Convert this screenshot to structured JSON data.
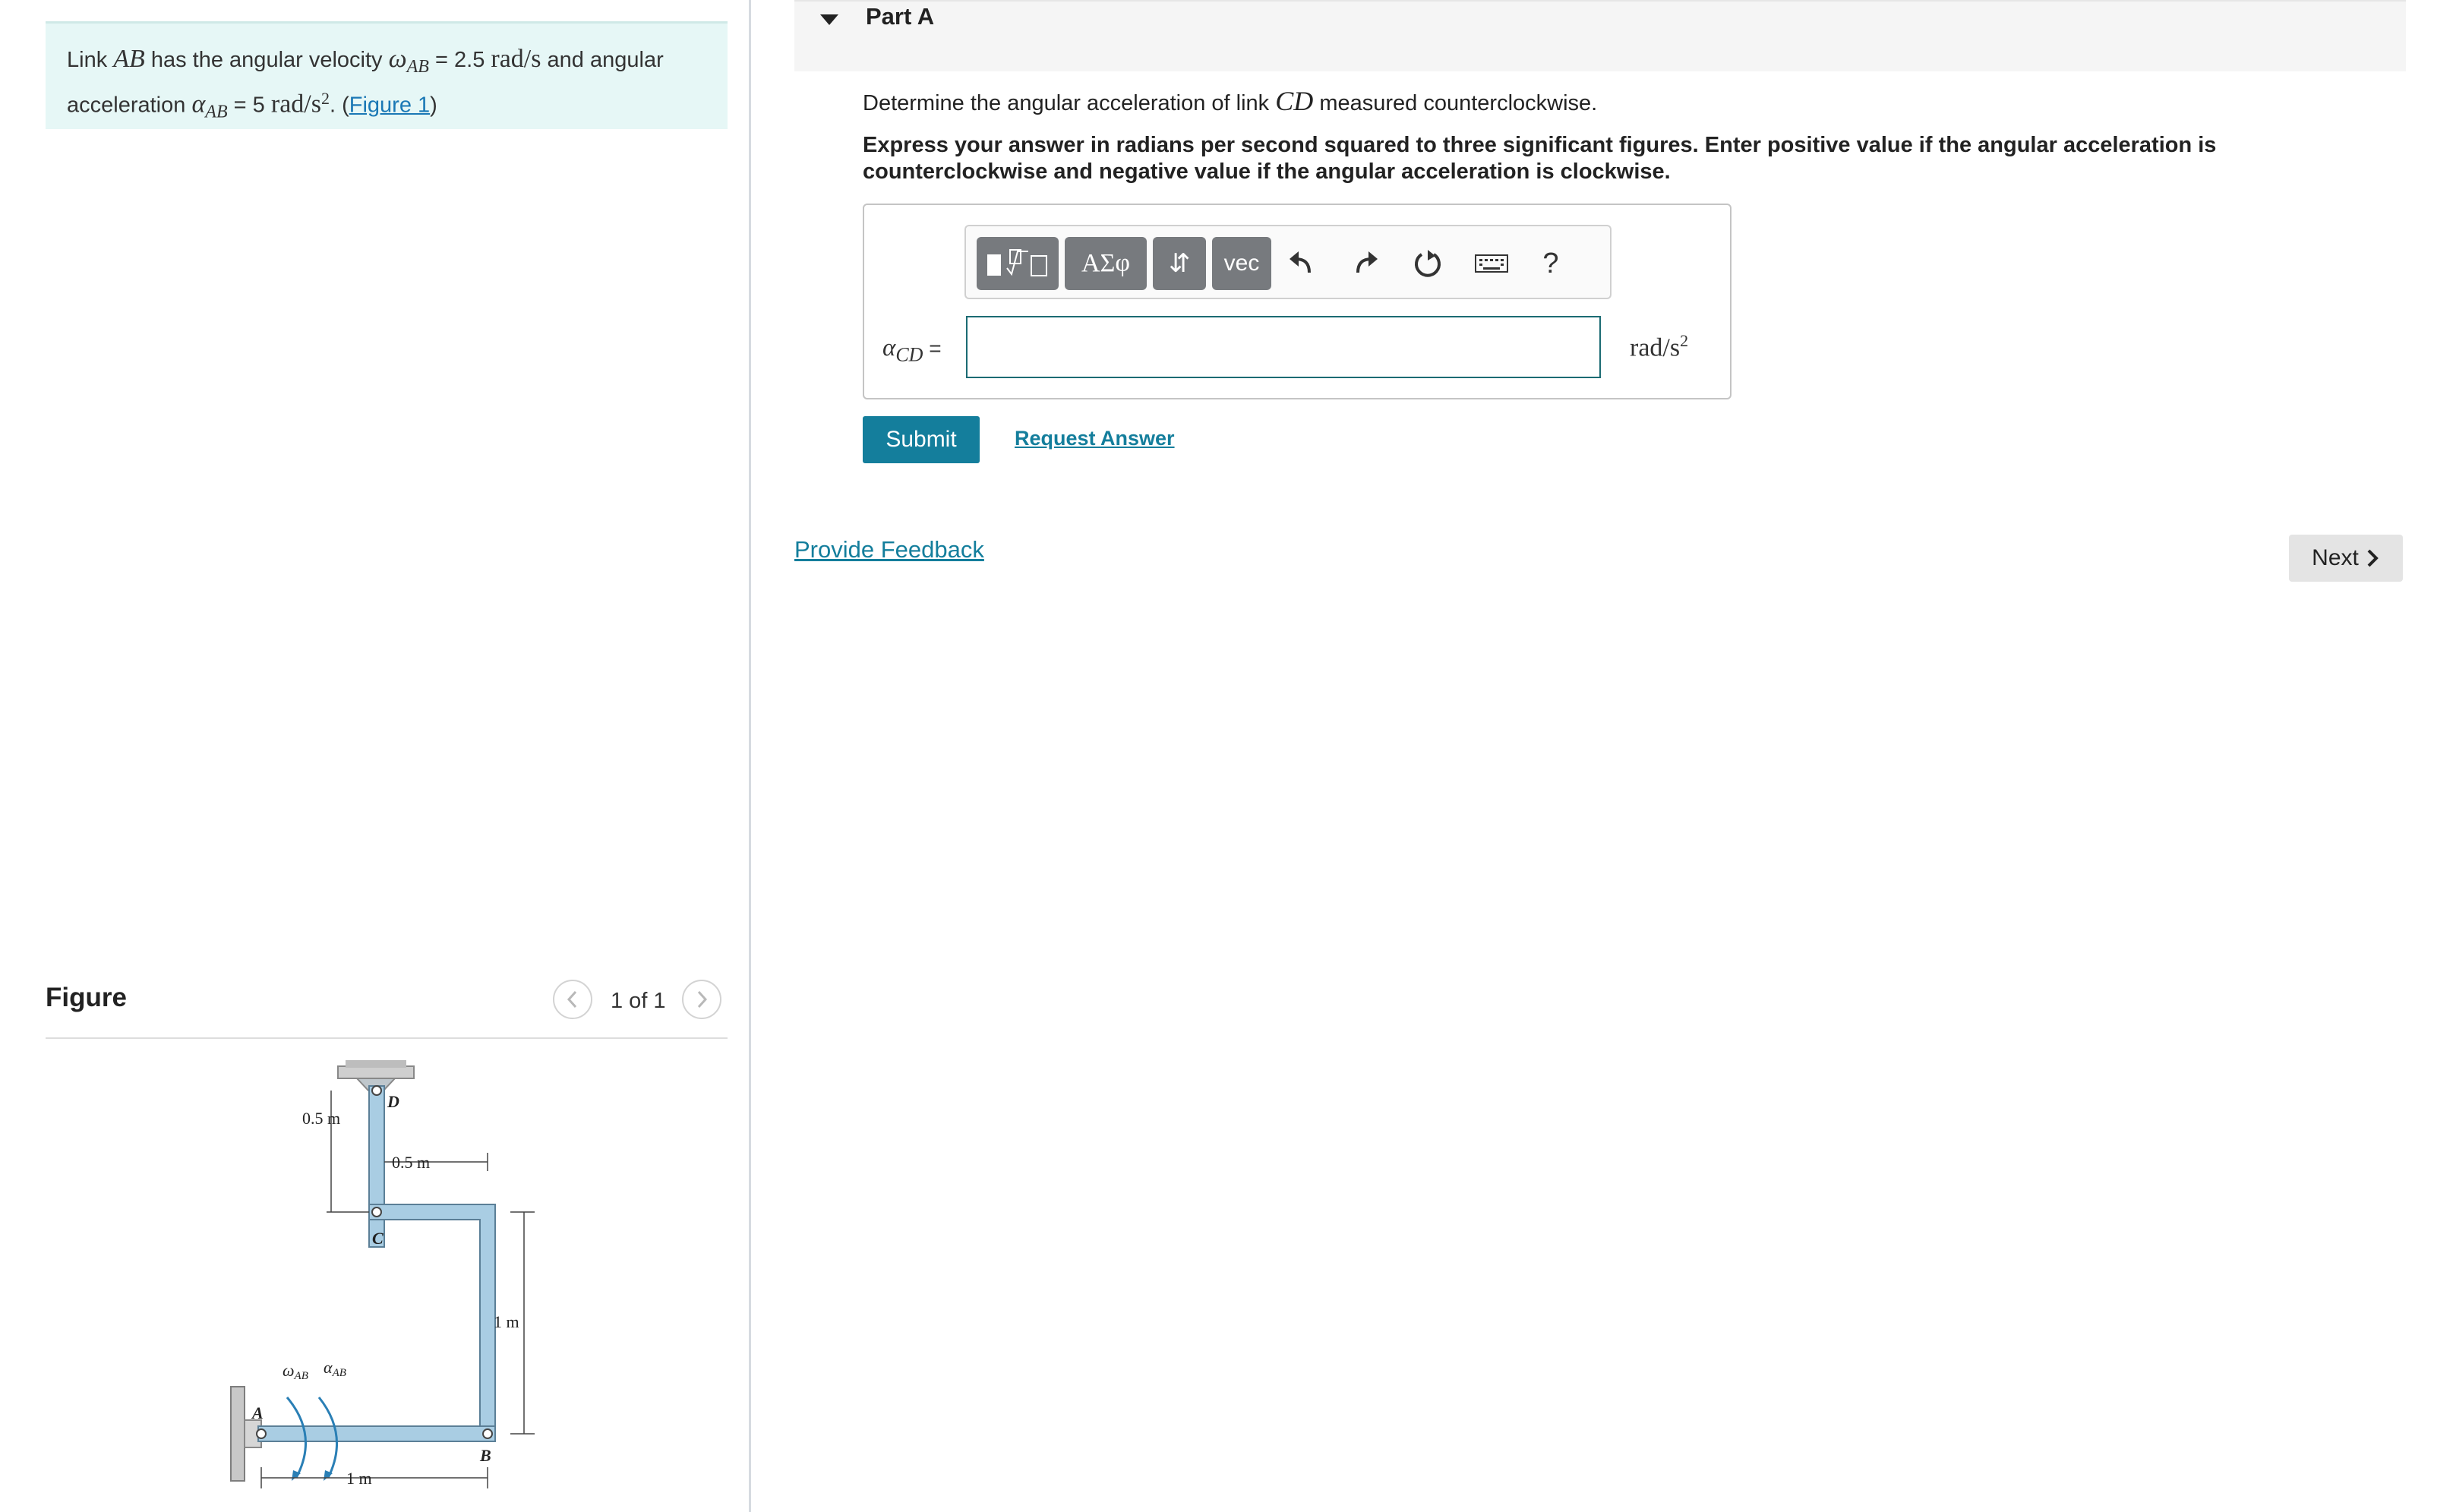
{
  "problem": {
    "intro": "Link ",
    "link_name": "AB",
    "velocity_text": " has the angular velocity ",
    "omega_symbol": "ω",
    "omega_sub": "AB",
    "omega_eq": " = 2.5 ",
    "omega_unit": "rad/s",
    "and_text": " and angular",
    "accel_text": "acceleration ",
    "alpha_symbol": "α",
    "alpha_sub": "AB",
    "alpha_eq": " = 5 ",
    "alpha_unit": "rad/s",
    "alpha_unit_exp": "2",
    "period": ". (",
    "figure_link": "Figure 1",
    "close": ")"
  },
  "figure": {
    "title": "Figure",
    "counter": "1 of 1",
    "labels": {
      "d": "D",
      "c": "C",
      "a": "A",
      "b": "B",
      "dim_cd": "0.5 m",
      "dim_top": "0.5 m",
      "dim_right": "1 m",
      "dim_bottom": "1 m",
      "omega": "ω",
      "omega_sub": "AB",
      "alpha": "α",
      "alpha_sub": "AB"
    }
  },
  "part": {
    "title": "Part A",
    "question_pre": "Determine the angular acceleration of link ",
    "question_link": "CD",
    "question_post": " measured counterclockwise.",
    "instructions": "Express your answer in radians per second squared to three significant figures. Enter positive value if the angular acceleration is counterclockwise and negative value if the angular acceleration is clockwise."
  },
  "toolbar": {
    "templates_icon": "templates-icon",
    "greek_label": "ΑΣφ",
    "arrows_label": "⇵",
    "vec_label": "vec",
    "undo_icon": "undo-icon",
    "redo_icon": "redo-icon",
    "reset_icon": "reset-icon",
    "keyboard_icon": "keyboard-icon",
    "help_label": "?"
  },
  "answer": {
    "symbol": "α",
    "sub": "CD",
    "eq": " =",
    "value": "",
    "unit": "rad/s",
    "unit_exp": "2"
  },
  "actions": {
    "submit": "Submit",
    "request_answer": "Request Answer",
    "provide_feedback": "Provide Feedback",
    "next": "Next"
  },
  "colors": {
    "accent": "#147e9c",
    "problem_bg": "#e6f7f6",
    "toolbar_button": "#777a7e",
    "link_fill": "#a9cde3"
  }
}
